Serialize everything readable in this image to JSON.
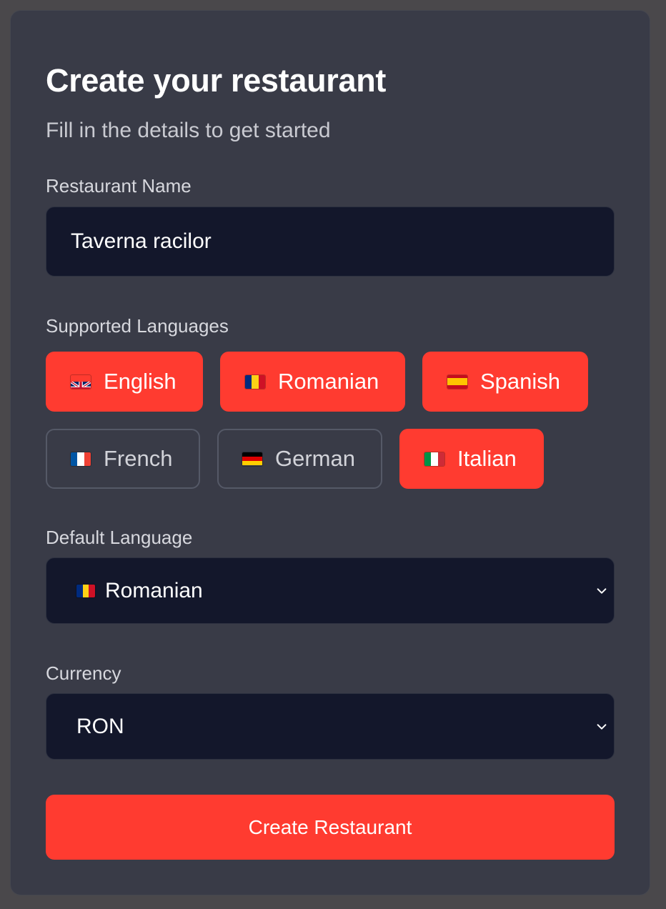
{
  "form": {
    "title": "Create your restaurant",
    "subtitle": "Fill in the details to get started",
    "name_label": "Restaurant Name",
    "name_value": "Taverna racilor",
    "languages_label": "Supported Languages",
    "languages": [
      {
        "label": "English",
        "flag": "uk-flag-icon",
        "selected": true
      },
      {
        "label": "Romanian",
        "flag": "romania-flag-icon",
        "selected": true
      },
      {
        "label": "Spanish",
        "flag": "spain-flag-icon",
        "selected": true
      },
      {
        "label": "French",
        "flag": "france-flag-icon",
        "selected": false
      },
      {
        "label": "German",
        "flag": "germany-flag-icon",
        "selected": false
      },
      {
        "label": "Italian",
        "flag": "italy-flag-icon",
        "selected": true
      }
    ],
    "default_language_label": "Default Language",
    "default_language_value": "Romanian",
    "currency_label": "Currency",
    "currency_value": "RON",
    "submit_label": "Create Restaurant"
  },
  "colors": {
    "accent": "#ff3b30",
    "card_background": "#393b47",
    "field_background": "#13172b",
    "page_background": "#4a484b"
  }
}
